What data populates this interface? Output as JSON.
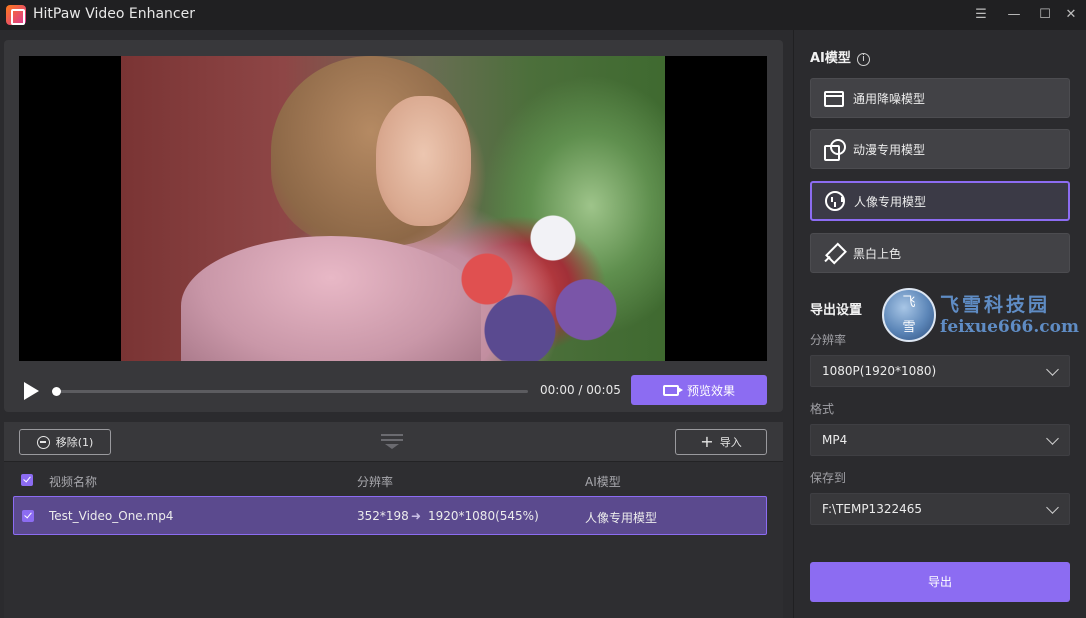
{
  "app": {
    "title": "HitPaw Video Enhancer",
    "window_controls": {
      "menu": "☰",
      "minimize": "—",
      "maximize": "☐",
      "close": "✕"
    }
  },
  "player": {
    "time": "00:00 / 00:05",
    "progress": 0,
    "preview_label": "预览效果"
  },
  "list": {
    "remove_label": "移除(1)",
    "import_label": "导入",
    "headers": {
      "name": "视频名称",
      "resolution": "分辨率",
      "model": "AI模型"
    },
    "rows": [
      {
        "name": "Test_Video_One.mp4",
        "src_res": "352*198",
        "arrow": "➜",
        "dst_res": "1920*1080(545%)",
        "model": "人像专用模型",
        "checked": true
      }
    ]
  },
  "right": {
    "ai_title": "AI模型",
    "info_icon": "i",
    "models": [
      {
        "label": "通用降噪模型",
        "icon": "clapper-icon",
        "active": false
      },
      {
        "label": "动漫专用模型",
        "icon": "anime-icon",
        "active": false
      },
      {
        "label": "人像专用模型",
        "icon": "portrait-icon",
        "active": true
      },
      {
        "label": "黑白上色",
        "icon": "colorize-icon",
        "active": false
      }
    ],
    "export_title": "导出设置",
    "resolution_label": "分辨率",
    "resolution_value": "1080P(1920*1080)",
    "format_label": "格式",
    "format_value": "MP4",
    "save_label": "保存到",
    "save_value": "F:\\TEMP1322465",
    "export_button": "导出"
  },
  "watermark": {
    "seal_text": "飞\n雪",
    "cn": "飞雪科技园",
    "en": "feixue666.com"
  },
  "colors": {
    "accent": "#8c6cf2",
    "panel": "#38383b",
    "background": "#2b2b2e"
  }
}
